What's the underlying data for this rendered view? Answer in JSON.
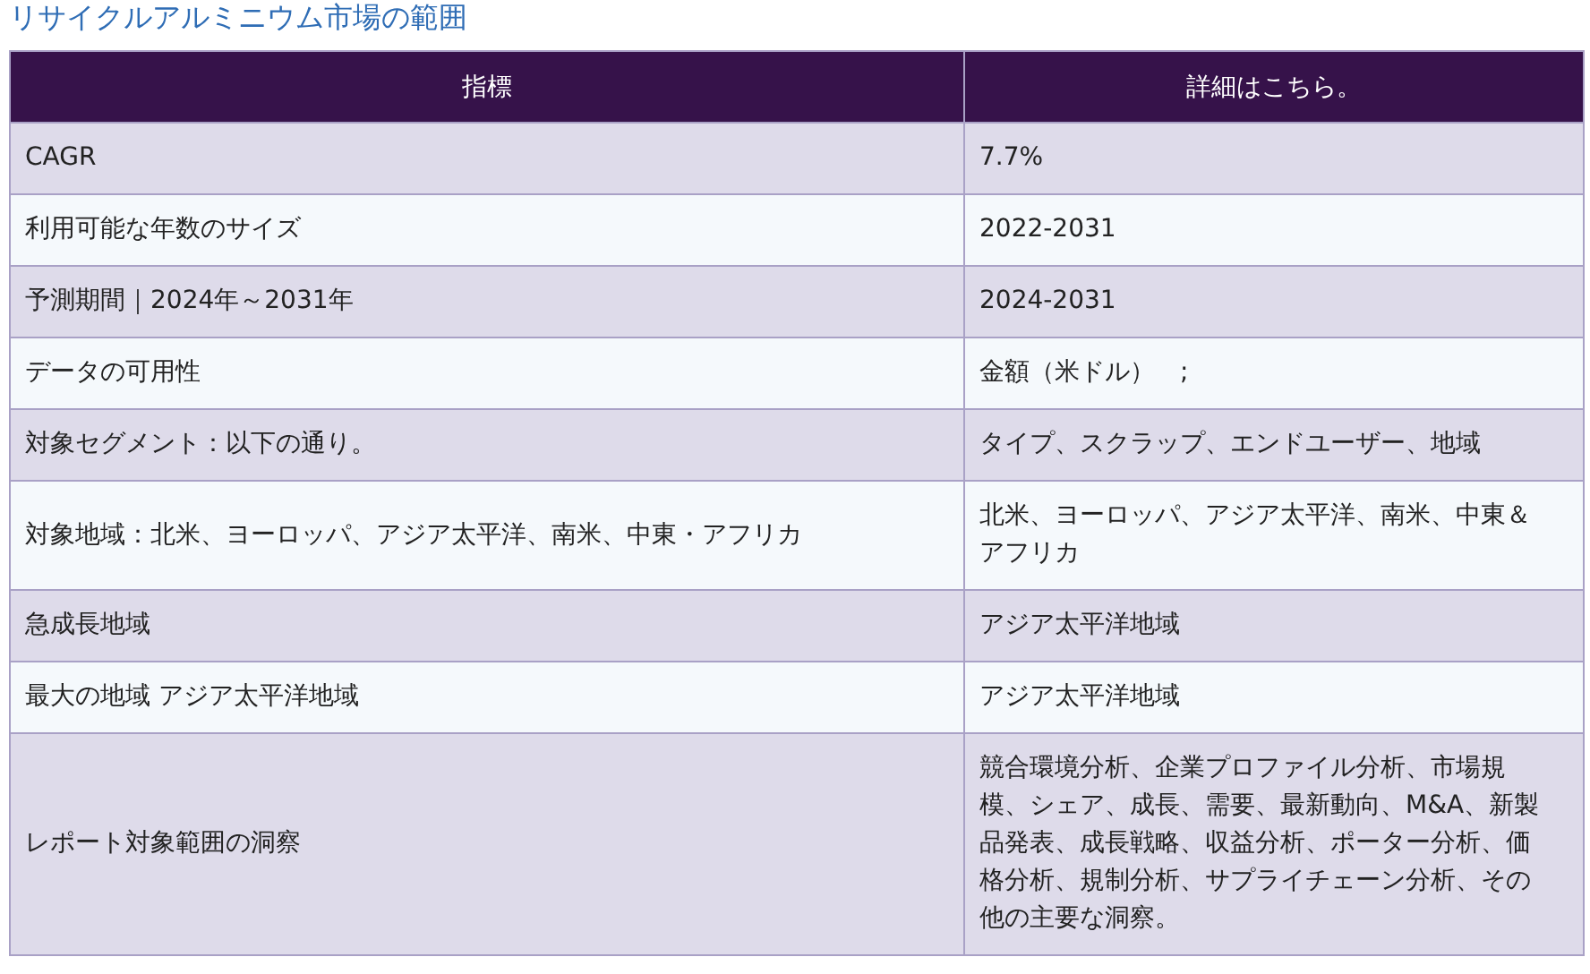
{
  "title": "リサイクルアルミニウム市場の範囲",
  "table": {
    "columns": [
      "指標",
      "詳細はこちら。"
    ],
    "rows": [
      {
        "cells": [
          "CAGR",
          "7.7%"
        ]
      },
      {
        "cells": [
          "利用可能な年数のサイズ",
          "2022-2031"
        ]
      },
      {
        "cells": [
          "予測期間｜2024年～2031年",
          "2024-2031"
        ]
      },
      {
        "cells": [
          "データの可用性",
          "金額（米ドル）　;"
        ]
      },
      {
        "cells": [
          "対象セグメント：以下の通り。",
          "タイプ、スクラップ、エンドユーザー、地域"
        ]
      },
      {
        "cells": [
          "対象地域：北米、ヨーロッパ、アジア太平洋、南米、中東・アフリカ",
          "北米、ヨーロッパ、アジア太平洋、南米、中東＆アフリカ"
        ]
      },
      {
        "cells": [
          "急成長地域",
          "アジア太平洋地域"
        ]
      },
      {
        "cells": [
          "最大の地域 アジア太平洋地域",
          "アジア太平洋地域"
        ]
      },
      {
        "cells": [
          "レポート対象範囲の洞察",
          "競合環境分析、企業プロファイル分析、市場規模、シェア、成長、需要、最新動向、M&A、新製品発表、成長戦略、収益分析、ポーター分析、価格分析、規制分析、サプライチェーン分析、その他の主要な洞察。"
        ]
      }
    ]
  }
}
